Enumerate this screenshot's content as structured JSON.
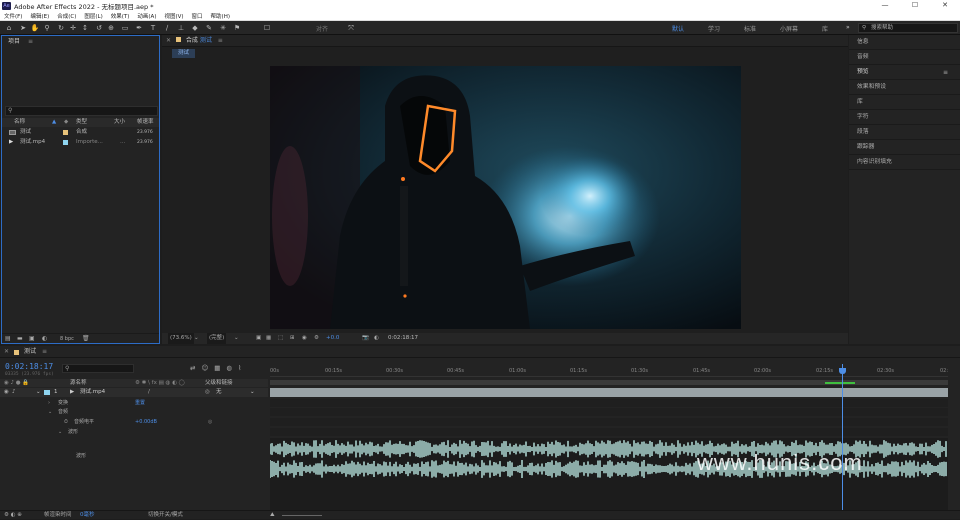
{
  "titlebar": {
    "logo": "Ae",
    "title": "Adobe After Effects 2022 - 无标题项目.aep *",
    "min": "—",
    "max": "☐",
    "close": "✕"
  },
  "menu": [
    "文件(F)",
    "编辑(E)",
    "合成(C)",
    "图层(L)",
    "效果(T)",
    "动画(A)",
    "视图(V)",
    "窗口",
    "帮助(H)"
  ],
  "toolbar": {
    "align_label": "对齐",
    "workspaces": [
      "默认",
      "学习",
      "标准",
      "小屏幕",
      "库"
    ],
    "more": "»",
    "help_search_placeholder": "搜索帮助"
  },
  "project": {
    "title": "项目",
    "columns": [
      "名称",
      "类型",
      "大小",
      "帧速率"
    ],
    "items": [
      {
        "name": "测试",
        "type": "合成",
        "fps": "23.976",
        "color": "#e8c27a"
      },
      {
        "name": "测试.mp4",
        "type": "Importe...",
        "size": "...",
        "fps": "23.976",
        "color": "#8fd4ef"
      }
    ],
    "bpc": "8 bpc"
  },
  "composition": {
    "panel_label": "合成",
    "comp_name": "测试",
    "tab": "测试",
    "zoom": "(73.6%)",
    "resolution": "(完整)",
    "exposure": "+0.0",
    "timecode": "0:02:18:17"
  },
  "right_panel": {
    "items": [
      "信息",
      "音频",
      "预览",
      "效果和预设",
      "库",
      "字符",
      "段落",
      "跟踪器",
      "内容识别填充"
    ]
  },
  "timeline": {
    "comp_tab": "测试",
    "timecode": "0:02:18:17",
    "sub_timecode": "03335 (23.976 fps)",
    "columns": [
      "源名称",
      "父级和链接"
    ],
    "layer": {
      "index": "1",
      "name": "测试.mp4",
      "parent": "无"
    },
    "rows": [
      {
        "label": "变换",
        "value": "重置"
      },
      {
        "label": "音频",
        "value": ""
      },
      {
        "label": "音频电平",
        "value": "+0.00dB"
      },
      {
        "label": "波形",
        "value": ""
      },
      {
        "label": "波形",
        "value": ""
      }
    ],
    "ruler": [
      "00s",
      "00:15s",
      "00:30s",
      "00:45s",
      "01:00s",
      "01:15s",
      "01:30s",
      "01:45s",
      "02:00s",
      "02:15s",
      "02:30s",
      "02:"
    ],
    "playhead_fraction": 0.844,
    "footer": {
      "render_time_label": "帧渲染时间",
      "render_time_value": "0毫秒",
      "toggle_label": "切换开关/模式"
    }
  },
  "watermark": "www.hunis.com",
  "colors": {
    "accent": "#2d6cc6",
    "timecode": "#4d8ee6",
    "waveform": "#a8d0cc"
  }
}
